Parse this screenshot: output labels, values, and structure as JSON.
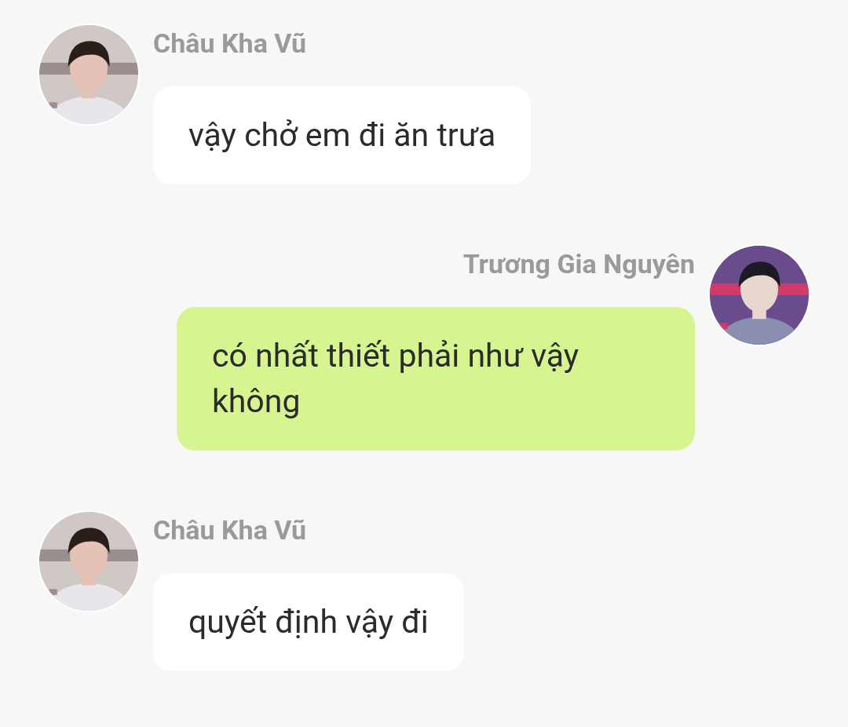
{
  "messages": [
    {
      "kind": "incoming",
      "sender": "Châu Kha Vũ",
      "text": "vậy chở em đi ăn trưa"
    },
    {
      "kind": "outgoing",
      "sender": "Trương Gia Nguyên",
      "text": "có nhất thiết phải như vậy không"
    },
    {
      "kind": "incoming",
      "sender": "Châu Kha Vũ",
      "text": "quyết định vậy đi"
    }
  ]
}
